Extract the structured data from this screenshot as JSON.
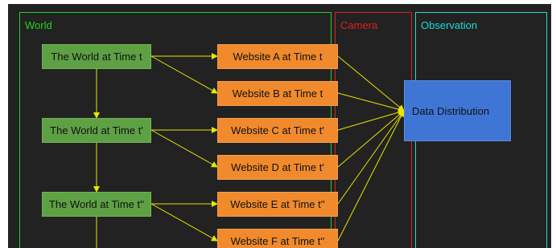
{
  "regions": {
    "world": {
      "label": "World",
      "color": "#22d422"
    },
    "camera": {
      "label": "Camera",
      "color": "#e01f1f"
    },
    "observation": {
      "label": "Observation",
      "color": "#1ed9d9"
    }
  },
  "world_nodes": [
    {
      "label": "The World at Time t"
    },
    {
      "label": "The World at Time t'"
    },
    {
      "label": "The World at Time t''"
    }
  ],
  "website_nodes": [
    {
      "label": "Website A at Time t"
    },
    {
      "label": "Website B at Time t"
    },
    {
      "label": "Website C at Time t'"
    },
    {
      "label": "Website D at Time t'"
    },
    {
      "label": "Website E at Time t''"
    },
    {
      "label": "Website F at Time t''"
    }
  ],
  "distribution_node": {
    "label": "Data Distribution"
  },
  "colors": {
    "background": "#222222",
    "world_fill": "#5ea044",
    "website_fill": "#f08a2c",
    "distribution_fill": "#3f76d6",
    "arrow": "#e6e600"
  }
}
